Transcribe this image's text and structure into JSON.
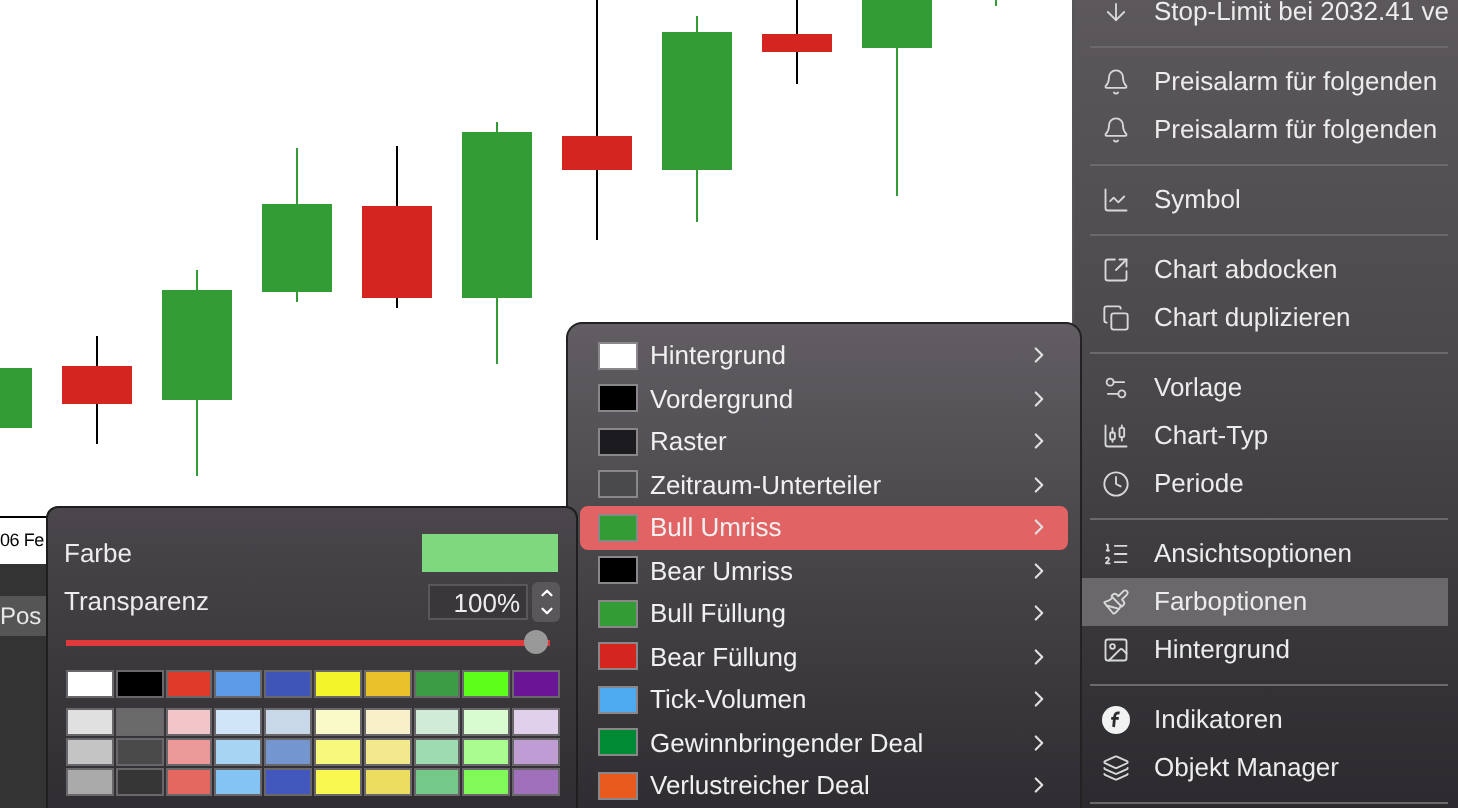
{
  "chart_axis_label": "06 Fe",
  "panel_header": "Pos",
  "context_menu": {
    "groups": [
      {
        "items": [
          {
            "label": "Stop-Limit bei 2032.41 ve",
            "selected": false
          }
        ]
      },
      {
        "items": [
          {
            "label": "Preisalarm für folgenden",
            "selected": false
          },
          {
            "label": "Preisalarm für folgenden",
            "selected": false
          }
        ]
      },
      {
        "items": [
          {
            "label": "Symbol",
            "selected": false
          }
        ]
      },
      {
        "items": [
          {
            "label": "Chart abdocken",
            "selected": false
          },
          {
            "label": "Chart duplizieren",
            "selected": false
          }
        ]
      },
      {
        "items": [
          {
            "label": "Vorlage",
            "selected": false
          },
          {
            "label": "Chart-Typ",
            "selected": false
          },
          {
            "label": "Periode",
            "selected": false
          }
        ]
      },
      {
        "items": [
          {
            "label": "Ansichtsoptionen",
            "selected": false
          },
          {
            "label": "Farboptionen",
            "selected": true
          },
          {
            "label": "Hintergrund",
            "selected": false
          }
        ]
      },
      {
        "items": [
          {
            "label": "Indikatoren",
            "selected": false
          },
          {
            "label": "Objekt Manager",
            "selected": false
          }
        ]
      }
    ]
  },
  "color_submenu": {
    "items": [
      {
        "label": "Hintergrund",
        "color": "#ffffff",
        "selected": false
      },
      {
        "label": "Vordergrund",
        "color": "#000000",
        "selected": false
      },
      {
        "label": "Raster",
        "color": "#1c1b1f",
        "selected": false
      },
      {
        "label": "Zeitraum-Unterteiler",
        "color": "#4a4a4c",
        "selected": false
      },
      {
        "label": "Bull Umriss",
        "color": "#349c34",
        "selected": true
      },
      {
        "label": "Bear Umriss",
        "color": "#000000",
        "selected": false
      },
      {
        "label": "Bull Füllung",
        "color": "#349c34",
        "selected": false
      },
      {
        "label": "Bear Füllung",
        "color": "#d4261e",
        "selected": false
      },
      {
        "label": "Tick-Volumen",
        "color": "#4eaaf0",
        "selected": false
      },
      {
        "label": "Gewinnbringender Deal",
        "color": "#008a34",
        "selected": false
      },
      {
        "label": "Verlustreicher Deal",
        "color": "#e85a1e",
        "selected": false
      }
    ]
  },
  "color_panel": {
    "color_label": "Farbe",
    "color": "#7ed87e",
    "transparency_label": "Transparenz",
    "transparency_value": "100%",
    "slider": {
      "level": 1
    },
    "palette": [
      [
        {
          "color": "#ffffff"
        },
        {
          "color": "#000000"
        },
        {
          "color": "#e03a2a"
        },
        {
          "color": "#5b9be8"
        },
        {
          "color": "#3f56b8"
        },
        {
          "color": "#f4f42a"
        },
        {
          "color": "#e8c228"
        },
        {
          "color": "#3c9c44"
        },
        {
          "color": "#5cff1a"
        },
        {
          "color": "#6a1596"
        }
      ],
      [
        {
          "color": "#e0e0e0"
        },
        {
          "color": "#6a6a6a"
        },
        {
          "color": "#f2c6c8"
        },
        {
          "color": "#d0e6f8"
        },
        {
          "color": "#c8d8e8"
        },
        {
          "color": "#fafac8"
        },
        {
          "color": "#f8f0c8"
        },
        {
          "color": "#d0ecd8"
        },
        {
          "color": "#d8fcd0"
        },
        {
          "color": "#e0d0ec"
        }
      ],
      [
        {
          "color": "#c4c4c4"
        },
        {
          "color": "#4a4a4a"
        },
        {
          "color": "#ea9898"
        },
        {
          "color": "#a8d4f4"
        },
        {
          "color": "#7496d0"
        },
        {
          "color": "#f8f87c"
        },
        {
          "color": "#f2e88c"
        },
        {
          "color": "#9cdcb0"
        },
        {
          "color": "#a8fc90"
        },
        {
          "color": "#c09cd4"
        }
      ],
      [
        {
          "color": "#aaaaaa"
        },
        {
          "color": "#363636"
        },
        {
          "color": "#e46860"
        },
        {
          "color": "#84c4f4"
        },
        {
          "color": "#4258bc"
        },
        {
          "color": "#f8f850"
        },
        {
          "color": "#ecdc60"
        },
        {
          "color": "#74c888"
        },
        {
          "color": "#80fa58"
        },
        {
          "color": "#a070bc"
        }
      ]
    ]
  }
}
